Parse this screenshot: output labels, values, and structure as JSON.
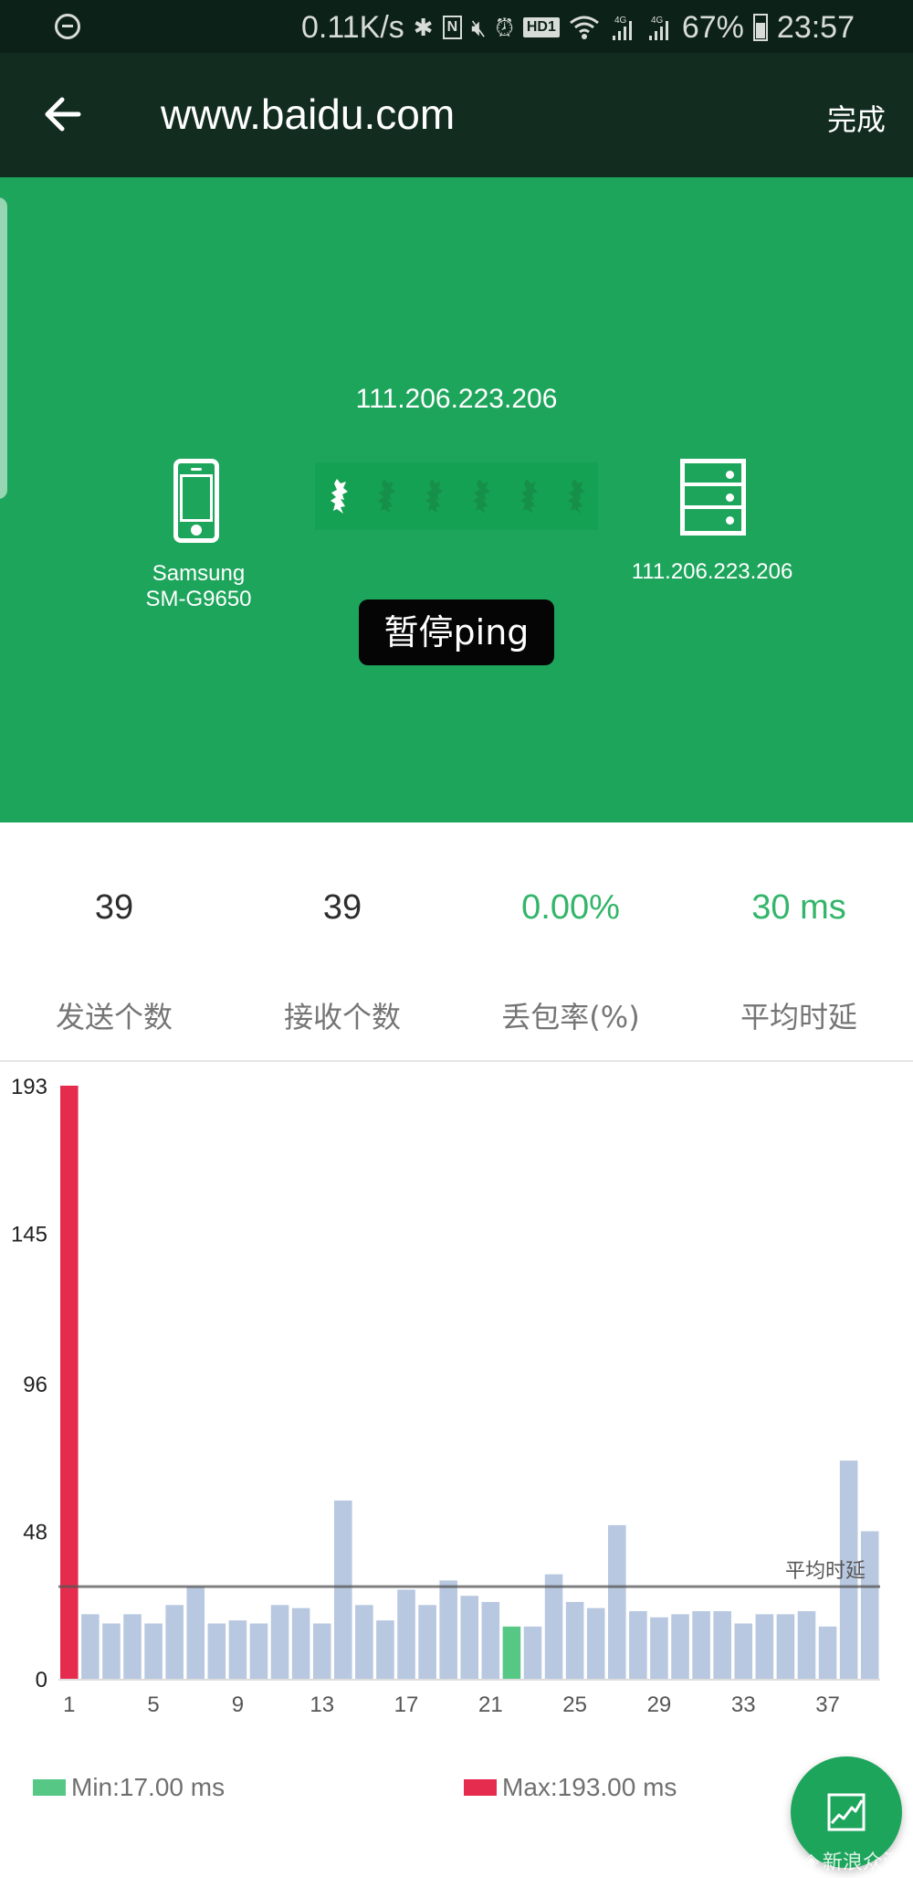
{
  "status_bar": {
    "net_speed": "0.11K/s",
    "icons": [
      "do-not-disturb-icon",
      "bluetooth-icon",
      "nfc-icon",
      "vibrate-mute-icon",
      "alarm-icon",
      "hd-voice-icon",
      "wifi-icon",
      "signal-4g-icon",
      "signal-4g-icon"
    ],
    "hd_label": "HD1",
    "nfc_label": "N",
    "network_labels": [
      "4G",
      "4G"
    ],
    "battery": "67%",
    "battery_level": 0.67,
    "time": "23:57"
  },
  "app_bar": {
    "back_icon": "arrow-left-icon",
    "title": "www.baidu.com",
    "done_label": "完成"
  },
  "hero": {
    "target_ip": "111.206.223.206",
    "device_line1": "Samsung",
    "device_line2": "SM-G9650",
    "server_ip": "111.206.223.206",
    "pause_button": "暂停ping",
    "packet_count": 6,
    "active_packet_index": 0,
    "bg_color": "#1ea55c"
  },
  "stats": [
    {
      "value": "39",
      "label": "发送个数",
      "highlight": false
    },
    {
      "value": "39",
      "label": "接收个数",
      "highlight": false
    },
    {
      "value": "0.00%",
      "label": "丢包率(%)",
      "highlight": true
    },
    {
      "value": "30 ms",
      "label": "平均时延",
      "highlight": true
    }
  ],
  "chart_data": {
    "type": "bar",
    "title": "",
    "xlabel": "",
    "ylabel": "",
    "categories": [
      1,
      2,
      3,
      4,
      5,
      6,
      7,
      8,
      9,
      10,
      11,
      12,
      13,
      14,
      15,
      16,
      17,
      18,
      19,
      20,
      21,
      22,
      23,
      24,
      25,
      26,
      27,
      28,
      29,
      30,
      31,
      32,
      33,
      34,
      35,
      36,
      37,
      38,
      39
    ],
    "values": [
      193,
      21,
      18,
      21,
      18,
      24,
      30,
      18,
      19,
      18,
      24,
      23,
      18,
      58,
      24,
      19,
      29,
      24,
      32,
      27,
      25,
      17,
      17,
      34,
      25,
      23,
      50,
      22,
      20,
      21,
      22,
      22,
      18,
      21,
      21,
      22,
      17,
      71,
      48
    ],
    "x_tick_labels": [
      "1",
      "5",
      "9",
      "13",
      "17",
      "21",
      "25",
      "29",
      "33",
      "37"
    ],
    "y_tick_labels": [
      "0",
      "48",
      "96",
      "145",
      "193"
    ],
    "y_ticks": [
      0,
      48,
      96,
      145,
      193
    ],
    "ylim": [
      0,
      193
    ],
    "average_line": {
      "value": 30,
      "label": "平均时延"
    },
    "min": {
      "index": 22,
      "value": 17,
      "label": "Min:17.00 ms",
      "color": "#57c785"
    },
    "max": {
      "index": 1,
      "value": 193,
      "label": "Max:193.00 ms",
      "color": "#e62c4e"
    },
    "bar_color": "#b8c8e0",
    "grid": false,
    "legend_position": "bottom"
  },
  "fab": {
    "icon": "chart-icon"
  },
  "watermark": "新浪众测"
}
